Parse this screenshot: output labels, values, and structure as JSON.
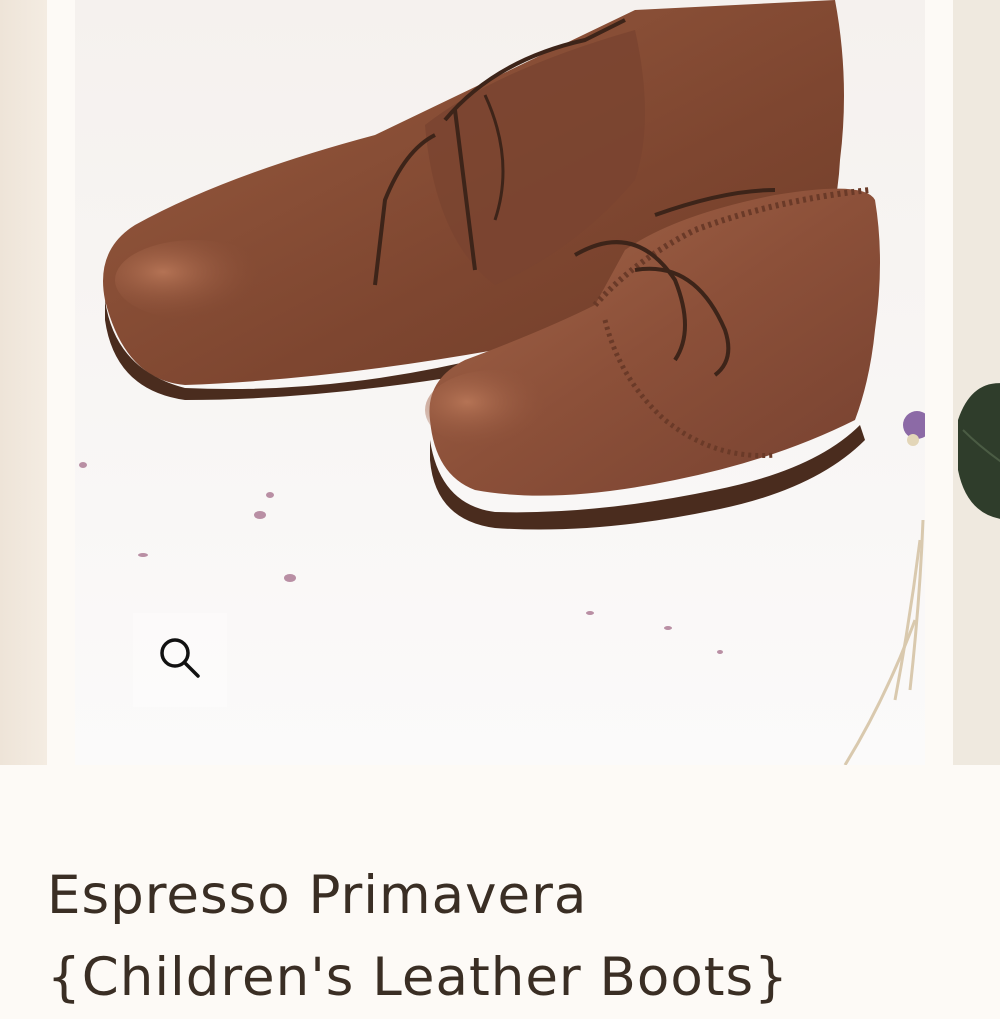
{
  "product": {
    "title_line1": "Espresso Primavera",
    "title_line2": "{Children's Leather Boots}"
  },
  "gallery": {
    "zoom_icon": "magnifier-icon"
  },
  "colors": {
    "background": "#fdfaf6",
    "title_text": "#3a2e24",
    "leather": "#8a5138",
    "sole": "#4a2c1e"
  }
}
